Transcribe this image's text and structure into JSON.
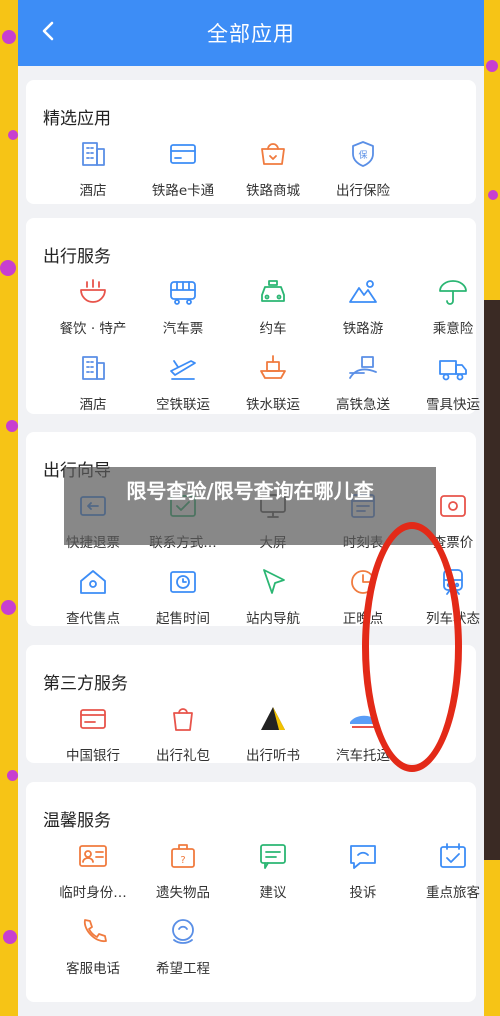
{
  "header": {
    "title": "全部应用"
  },
  "sections": [
    {
      "title": "精选应用",
      "items": [
        {
          "label": "酒店",
          "icon": "hotel-icon",
          "color": "#5a8fe6"
        },
        {
          "label": "铁路e卡通",
          "icon": "card-icon",
          "color": "#3d8df6"
        },
        {
          "label": "铁路商城",
          "icon": "shop-icon",
          "color": "#f07b3f"
        },
        {
          "label": "出行保险",
          "icon": "shield-icon",
          "color": "#5a8fe6"
        }
      ]
    },
    {
      "title": "出行服务",
      "items": [
        {
          "label": "餐饮 · 特产",
          "icon": "bowl-icon",
          "color": "#e8544b"
        },
        {
          "label": "汽车票",
          "icon": "bus-icon",
          "color": "#3d8df6"
        },
        {
          "label": "约车",
          "icon": "car-icon",
          "color": "#2bb673"
        },
        {
          "label": "铁路游",
          "icon": "mountain-icon",
          "color": "#3d8df6"
        },
        {
          "label": "乘意险",
          "icon": "umbrella-icon",
          "color": "#2bb673"
        },
        {
          "label": "酒店",
          "icon": "hotel-icon",
          "color": "#5a8fe6"
        },
        {
          "label": "空铁联运",
          "icon": "plane-icon",
          "color": "#3d8df6"
        },
        {
          "label": "铁水联运",
          "icon": "ship-icon",
          "color": "#f07b3f"
        },
        {
          "label": "高铁急送",
          "icon": "delivery-icon",
          "color": "#5a8fe6"
        },
        {
          "label": "雪具快运",
          "icon": "truck-icon",
          "color": "#3d8df6"
        }
      ]
    },
    {
      "title": "出行向导",
      "items": [
        {
          "label": "快捷退票",
          "icon": "ticket-refund-icon",
          "color": "#3d8df6"
        },
        {
          "label": "联系方式…",
          "icon": "contact-icon",
          "color": "#2bb673"
        },
        {
          "label": "大屏",
          "icon": "screen-icon",
          "color": "#555555"
        },
        {
          "label": "时刻表",
          "icon": "timetable-icon",
          "color": "#5a8fe6"
        },
        {
          "label": "查票价",
          "icon": "price-icon",
          "color": "#e8544b"
        },
        {
          "label": "查代售点",
          "icon": "house-icon",
          "color": "#3d8df6"
        },
        {
          "label": "起售时间",
          "icon": "clock-ticket-icon",
          "color": "#3d8df6"
        },
        {
          "label": "站内导航",
          "icon": "navigation-icon",
          "color": "#2bb673"
        },
        {
          "label": "正晚点",
          "icon": "clock-icon",
          "color": "#f07b3f"
        },
        {
          "label": "列车状态",
          "icon": "train-icon",
          "color": "#3d8df6"
        }
      ]
    },
    {
      "title": "第三方服务",
      "items": [
        {
          "label": "中国银行",
          "icon": "bank-card-icon",
          "color": "#e8544b"
        },
        {
          "label": "出行礼包",
          "icon": "gift-bag-icon",
          "color": "#e8544b"
        },
        {
          "label": "出行听书",
          "icon": "book-icon",
          "color": "#222222"
        },
        {
          "label": "汽车托运",
          "icon": "car-transport-icon",
          "color": "#3d8df6"
        }
      ]
    },
    {
      "title": "温馨服务",
      "items": [
        {
          "label": "临时身份…",
          "icon": "id-card-icon",
          "color": "#f07b3f"
        },
        {
          "label": "遗失物品",
          "icon": "lost-item-icon",
          "color": "#f07b3f"
        },
        {
          "label": "建议",
          "icon": "suggestion-icon",
          "color": "#2bb673"
        },
        {
          "label": "投诉",
          "icon": "complaint-icon",
          "color": "#3d8df6"
        },
        {
          "label": "重点旅客",
          "icon": "calendar-check-icon",
          "color": "#3d8df6"
        },
        {
          "label": "客服电话",
          "icon": "phone-icon",
          "color": "#f07b3f"
        },
        {
          "label": "希望工程",
          "icon": "heart-hand-icon",
          "color": "#5a8fe6"
        }
      ]
    }
  ],
  "overlay_text": "限号查验/限号查询在哪儿查",
  "colors": {
    "accent": "#3d8df6",
    "border": "#f6c416",
    "confetti": "#c83fd0",
    "ring": "#e32a18"
  }
}
